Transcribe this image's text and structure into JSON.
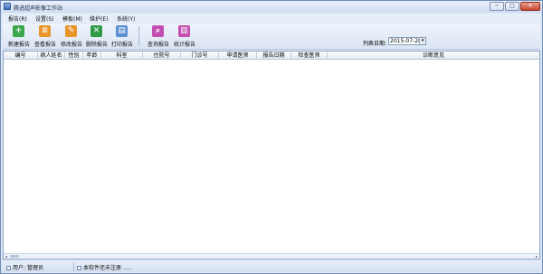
{
  "window": {
    "title": "腾进超声影像工作站",
    "min": "─",
    "max": "□",
    "close": "✕"
  },
  "menu": [
    "报告(R)",
    "设置(S)",
    "模板(M)",
    "维护(E)",
    "系统(Y)"
  ],
  "toolbar": {
    "items": [
      {
        "label": "新建报告",
        "icon": "new-report-icon",
        "color": "#3aa84a",
        "glyph": "+"
      },
      {
        "label": "查看报告",
        "icon": "view-report-icon",
        "color": "#e8952a",
        "glyph": "≡"
      },
      {
        "label": "修改报告",
        "icon": "edit-report-icon",
        "color": "#e8952a",
        "glyph": "✎"
      },
      {
        "label": "删除报告",
        "icon": "delete-report-icon",
        "color": "#2f9b46",
        "glyph": "✕"
      },
      {
        "label": "打印报告",
        "icon": "print-report-icon",
        "color": "#5a8fd0",
        "glyph": "▤"
      },
      {
        "label": "查询报告",
        "icon": "search-report-icon",
        "color": "#c34fb0",
        "glyph": "⌕"
      },
      {
        "label": "统计报告",
        "icon": "stats-report-icon",
        "color": "#c34fb0",
        "glyph": "▥"
      }
    ],
    "list_date_label": "列表日期:",
    "list_date_value": "2015-07-28",
    "dropdown_arrow": "▾"
  },
  "table": {
    "columns": [
      "编号",
      "病人姓名",
      "性别",
      "年龄",
      "科室",
      "住院号",
      "门诊号",
      "申请医师",
      "报告日期",
      "检查医师",
      "诊断意见"
    ]
  },
  "scroll": {
    "left": "◂",
    "right": "▸"
  },
  "status": {
    "user_label": "用户:",
    "user_value": "管理员",
    "license": "本软件还未注册",
    "dots": "....."
  }
}
